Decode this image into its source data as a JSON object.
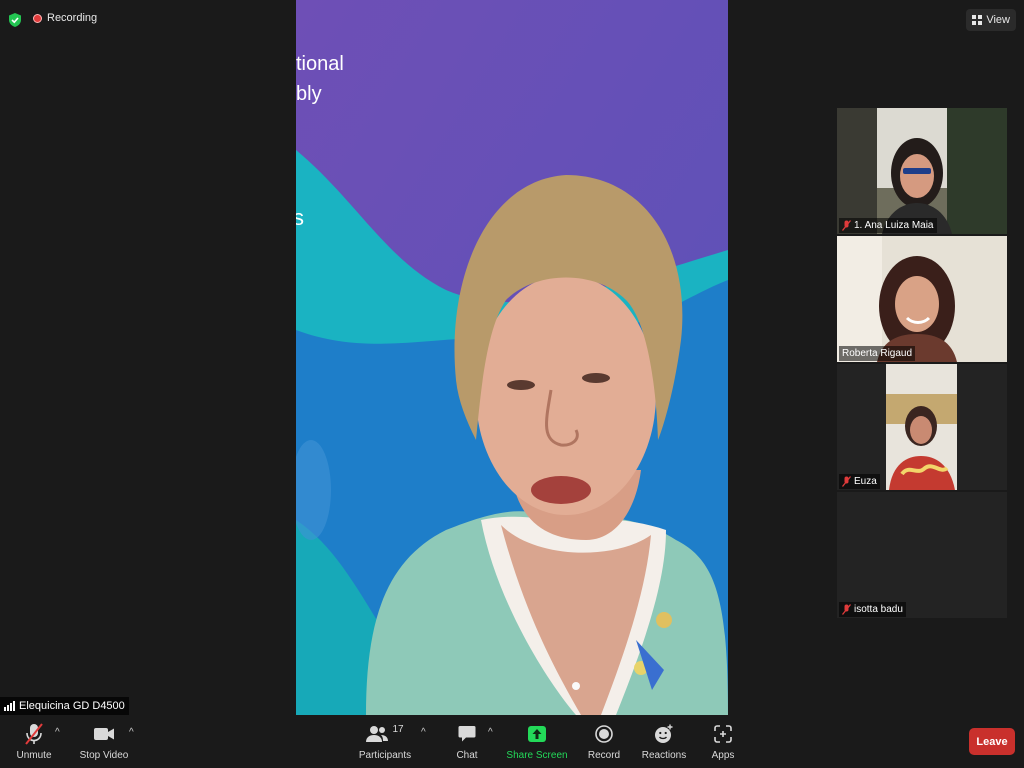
{
  "top_bar": {
    "recording_label": "Recording",
    "view_label": "View"
  },
  "main_video": {
    "backdrop_text_line1": "tional",
    "backdrop_text_line2": "bly",
    "backdrop_text_line3": "s"
  },
  "participants": [
    {
      "name": "1. Ana Luiza Maia",
      "muted": true
    },
    {
      "name": "Roberta Rigaud",
      "muted": false
    },
    {
      "name": "Euza",
      "muted": true
    },
    {
      "name": "isotta badu",
      "muted": true
    }
  ],
  "self_label": "Elequicina GD D4500",
  "toolbar": {
    "unmute_label": "Unmute",
    "stop_video_label": "Stop Video",
    "participants_label": "Participants",
    "participants_count": "17",
    "chat_label": "Chat",
    "share_screen_label": "Share Screen",
    "record_label": "Record",
    "reactions_label": "Reactions",
    "apps_label": "Apps",
    "leave_label": "Leave"
  },
  "colors": {
    "background": "#1a1a1a",
    "share_green": "#23d959",
    "leave_red": "#c9302c",
    "recording_red": "#e03b3b",
    "shield_green": "#23c552"
  }
}
